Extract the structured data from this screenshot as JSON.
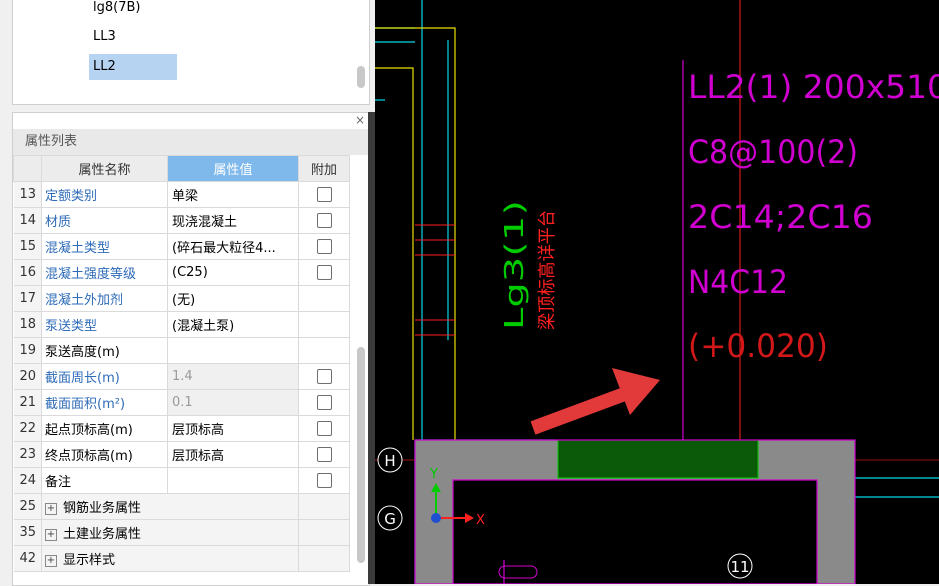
{
  "tree": {
    "items": [
      {
        "label": "lg8(7B)",
        "selected": false
      },
      {
        "label": "LL3",
        "selected": false
      },
      {
        "label": "LL2",
        "selected": true
      }
    ]
  },
  "props": {
    "close_glyph": "×",
    "title": "属性列表",
    "headers": {
      "name": "属性名称",
      "value": "属性值",
      "add": "附加"
    },
    "rows": [
      {
        "num": "13",
        "name": "定额类别",
        "value": "单梁",
        "blue": true,
        "checkbox": true,
        "gray": false
      },
      {
        "num": "14",
        "name": "材质",
        "value": "现浇混凝土",
        "blue": true,
        "checkbox": true,
        "gray": false
      },
      {
        "num": "15",
        "name": "混凝土类型",
        "value": "(碎石最大粒径4...",
        "blue": true,
        "checkbox": true,
        "gray": false
      },
      {
        "num": "16",
        "name": "混凝土强度等级",
        "value": "(C25)",
        "blue": true,
        "checkbox": true,
        "gray": false
      },
      {
        "num": "17",
        "name": "混凝土外加剂",
        "value": "(无)",
        "blue": true,
        "checkbox": false,
        "gray": false
      },
      {
        "num": "18",
        "name": "泵送类型",
        "value": "(混凝土泵)",
        "blue": true,
        "checkbox": false,
        "gray": false
      },
      {
        "num": "19",
        "name": "泵送高度(m)",
        "value": "",
        "blue": false,
        "checkbox": false,
        "gray": false
      },
      {
        "num": "20",
        "name": "截面周长(m)",
        "value": "1.4",
        "blue": true,
        "checkbox": true,
        "gray": true
      },
      {
        "num": "21",
        "name": "截面面积(m²)",
        "value": "0.1",
        "blue": true,
        "checkbox": true,
        "gray": true
      },
      {
        "num": "22",
        "name": "起点顶标高(m)",
        "value": "层顶标高",
        "blue": false,
        "checkbox": true,
        "gray": false
      },
      {
        "num": "23",
        "name": "终点顶标高(m)",
        "value": "层顶标高",
        "blue": false,
        "checkbox": true,
        "gray": false
      },
      {
        "num": "24",
        "name": "备注",
        "value": "",
        "blue": false,
        "checkbox": true,
        "gray": false
      }
    ],
    "groups": [
      {
        "num": "25",
        "plus": "+",
        "name": "钢筋业务属性"
      },
      {
        "num": "35",
        "plus": "+",
        "name": "土建业务属性"
      },
      {
        "num": "42",
        "plus": "+",
        "name": "显示样式"
      }
    ]
  },
  "cad": {
    "beam_text": [
      "LL2(1) 200x510",
      "C8@100(2)",
      "2C14;2C16",
      "N4C12",
      "(+0.020)"
    ],
    "lg_label": "Lg3(1)",
    "red_note": "梁顶标高详平台",
    "axis_h": "H",
    "axis_g": "G",
    "axis_11": "11",
    "ucs_y": "Y",
    "ucs_x": "X",
    "colors": {
      "magenta": "#d000d0",
      "cyan": "#00d8e8",
      "yellow": "#e8e000",
      "red": "#ff2020",
      "green": "#00cc00",
      "gray": "#8a8a8a",
      "dark_green": "#0a5a0a",
      "arrow": "#e23a3a"
    }
  }
}
